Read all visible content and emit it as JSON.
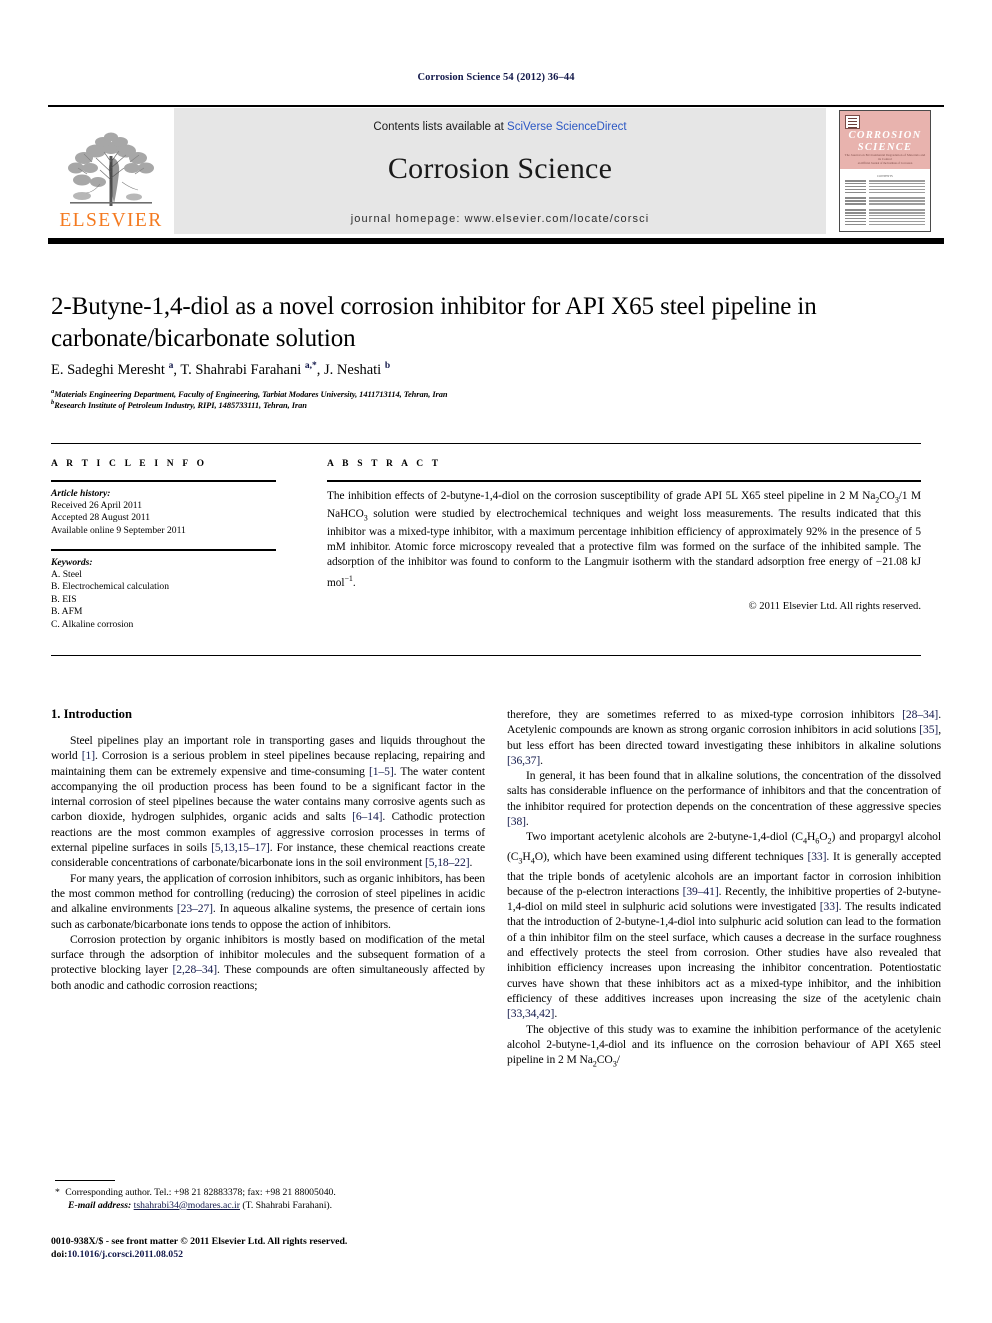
{
  "running_head": "Corrosion Science 54 (2012) 36–44",
  "masthead": {
    "contents_prefix": "Contents lists available at ",
    "sciencedirect": "SciVerse ScienceDirect",
    "journal_title": "Corrosion Science",
    "homepage": "journal homepage: www.elsevier.com/locate/corsci",
    "publisher_wordmark": "ELSEVIER",
    "cover": {
      "name_line1": "CORROSION",
      "name_line2": "SCIENCE",
      "tagline": "The Journal on Environmental Degradation of Materials and its Control",
      "subtitle": "an Official Journal of the Institute of Corrosion",
      "contents_label": "CONTENTS"
    },
    "colors": {
      "elsevier_orange": "#f47a20",
      "band_grey": "#e6e6e6",
      "cover_pink": "#e8b3ae",
      "link_blue": "#2b57c4",
      "ref_blue": "#12184a"
    }
  },
  "article": {
    "title": "2-Butyne-1,4-diol as a novel corrosion inhibitor for API X65 steel pipeline in carbonate/bicarbonate solution",
    "authors_html": "E. Sadeghi Meresht <sup>a</sup>, T. Shahrabi Farahani <sup>a,*</sup>, J. Neshati <sup>b</sup>",
    "affiliation_a": "Materials Engineering Department, Faculty of Engineering, Tarbiat Modares University, 1411713114, Tehran, Iran",
    "affiliation_b": "Research Institute of Petroleum Industry, RIPI, 1485733111, Tehran, Iran"
  },
  "article_info": {
    "label": "A R T I C L E  I N F O",
    "history_head": "Article history:",
    "history": [
      "Received 26 April 2011",
      "Accepted 28 August 2011",
      "Available online 9 September 2011"
    ],
    "keywords_head": "Keywords:",
    "keywords": [
      "A. Steel",
      "B. Electrochemical calculation",
      "B. EIS",
      "B. AFM",
      "C. Alkaline corrosion"
    ]
  },
  "abstract": {
    "label": "A B S T R A C T",
    "text_html": "The inhibition effects of 2-butyne-1,4-diol on the corrosion susceptibility of grade API 5L X65 steel pipeline in 2 M Na<sub>2</sub>CO<sub>3</sub>/1 M NaHCO<sub>3</sub> solution were studied by electrochemical techniques and weight loss measurements. The results indicated that this inhibitor was a mixed-type inhibitor, with a maximum percentage inhibition efficiency of approximately 92% in the presence of 5 mM inhibitor. Atomic force microscopy revealed that a protective film was formed on the surface of the inhibited sample. The adsorption of the inhibitor was found to conform to the Langmuir isotherm with the standard adsorption free energy of −21.08 kJ mol<sup>−1</sup>.",
    "copyright": "© 2011 Elsevier Ltd. All rights reserved."
  },
  "body": {
    "section_heading": "1. Introduction",
    "left_column_html": "<p>Steel pipelines play an important role in transporting gases and liquids throughout the world <span class=\"ref\">[1]</span>. Corrosion is a serious problem in steel pipelines because replacing, repairing and maintaining them can be extremely expensive and time-consuming <span class=\"ref\">[1–5]</span>. The water content accompanying the oil production process has been found to be a significant factor in the internal corrosion of steel pipelines because the water contains many corrosive agents such as carbon dioxide, hydrogen sulphides, organic acids and salts <span class=\"ref\">[6–14]</span>. Cathodic protection reactions are the most common examples of aggressive corrosion processes in terms of external pipeline surfaces in soils <span class=\"ref\">[5,13,15–17]</span>. For instance, these chemical reactions create considerable concentrations of carbonate/bicarbonate ions in the soil environment <span class=\"ref\">[5,18–22]</span>.</p><p>For many years, the application of corrosion inhibitors, such as organic inhibitors, has been the most common method for controlling (reducing) the corrosion of steel pipelines in acidic and alkaline environments <span class=\"ref\">[23–27]</span>. In aqueous alkaline systems, the presence of certain ions such as carbonate/bicarbonate ions tends to oppose the action of inhibitors.</p><p>Corrosion protection by organic inhibitors is mostly based on modification of the metal surface through the adsorption of inhibitor molecules and the subsequent formation of a protective blocking layer <span class=\"ref\">[2,28–34]</span>. These compounds are often simultaneously affected by both anodic and cathodic corrosion reactions;</p>",
    "right_column_html": "<p class=\"noind\">therefore, they are sometimes referred to as mixed-type corrosion inhibitors <span class=\"ref\">[28–34]</span>. Acetylenic compounds are known as strong organic corrosion inhibitors in acid solutions <span class=\"ref\">[35]</span>, but less effort has been directed toward investigating these inhibitors in alkaline solutions <span class=\"ref\">[36,37]</span>.</p><p>In general, it has been found that in alkaline solutions, the concentration of the dissolved salts has considerable influence on the performance of inhibitors and that the concentration of the inhibitor required for protection depends on the concentration of these aggressive species <span class=\"ref\">[38]</span>.</p><p>Two important acetylenic alcohols are 2-butyne-1,4-diol (C<sub>4</sub>H<sub>6</sub>O<sub>2</sub>) and propargyl alcohol (C<sub>3</sub>H<sub>4</sub>O), which have been examined using different techniques <span class=\"ref\">[33]</span>. It is generally accepted that the triple bonds of acetylenic alcohols are an important factor in corrosion inhibition because of the p-electron interactions <span class=\"ref\">[39–41]</span>. Recently, the inhibitive properties of 2-butyne-1,4-diol on mild steel in sulphuric acid solutions were investigated <span class=\"ref\">[33]</span>. The results indicated that the introduction of 2-butyne-1,4-diol into sulphuric acid solution can lead to the formation of a thin inhibitor film on the steel surface, which causes a decrease in the surface roughness and effectively protects the steel from corrosion. Other studies have also revealed that inhibition efficiency increases upon increasing the inhibitor concentration. Potentiostatic curves have shown that these inhibitors act as a mixed-type inhibitor, and the inhibition efficiency of these additives increases upon increasing the size of the acetylenic chain <span class=\"ref\">[33,34,42]</span>.</p><p>The objective of this study was to examine the inhibition performance of the acetylenic alcohol 2-butyne-1,4-diol and its influence on the corrosion behaviour of API X65 steel pipeline in 2 M Na<sub>2</sub>CO<sub>3</sub>/</p>"
  },
  "footnote": {
    "corresponding_html": "<span class=\"star\">*</span> Corresponding author. Tel.: +98 21 82883378; fax: +98 21 88005040.",
    "email_label": "E-mail address:",
    "email": "tshahrabi34@modares.ac.ir",
    "email_owner": "(T. Shahrabi Farahani)."
  },
  "footer": {
    "issn_line": "0010-938X/$ - see front matter © 2011 Elsevier Ltd. All rights reserved.",
    "doi_label": "doi:",
    "doi": "10.1016/j.corsci.2011.08.052"
  }
}
